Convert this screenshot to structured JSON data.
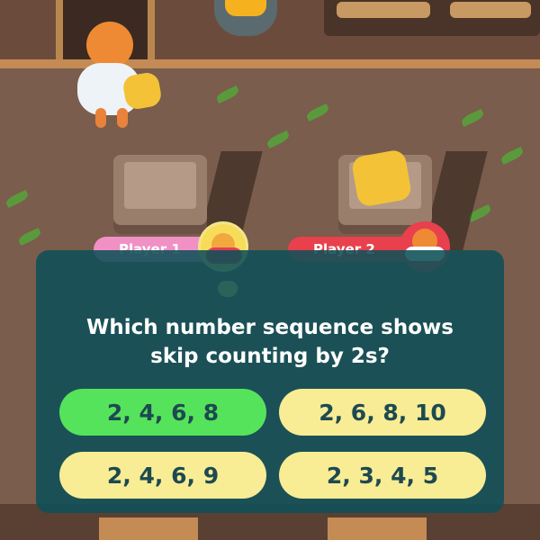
{
  "players": {
    "player1": {
      "label": "Player 1",
      "active": true,
      "color": "#f090c4"
    },
    "player2": {
      "label": "Player 2",
      "active": false,
      "color": "#e8404c"
    }
  },
  "question": {
    "text": "Which number sequence shows\nskip counting by 2s?"
  },
  "answers": [
    {
      "label": "2, 4, 6, 8",
      "state": "correct"
    },
    {
      "label": "2, 6, 8, 10",
      "state": "normal"
    },
    {
      "label": "2, 4, 6, 9",
      "state": "normal"
    },
    {
      "label": "2, 3, 4, 5",
      "state": "normal"
    }
  ],
  "colors": {
    "panel": "#0e5058",
    "correct_answer": "#56e35c",
    "answer_default": "#f8ec95",
    "answer_text": "#1d4a50"
  },
  "icons": {
    "player1_avatar": "player1-avatar-icon",
    "player2_avatar": "player2-avatar-icon",
    "turn_pointer": "turn-pointer-icon",
    "gem": "gold-gem-icon"
  }
}
